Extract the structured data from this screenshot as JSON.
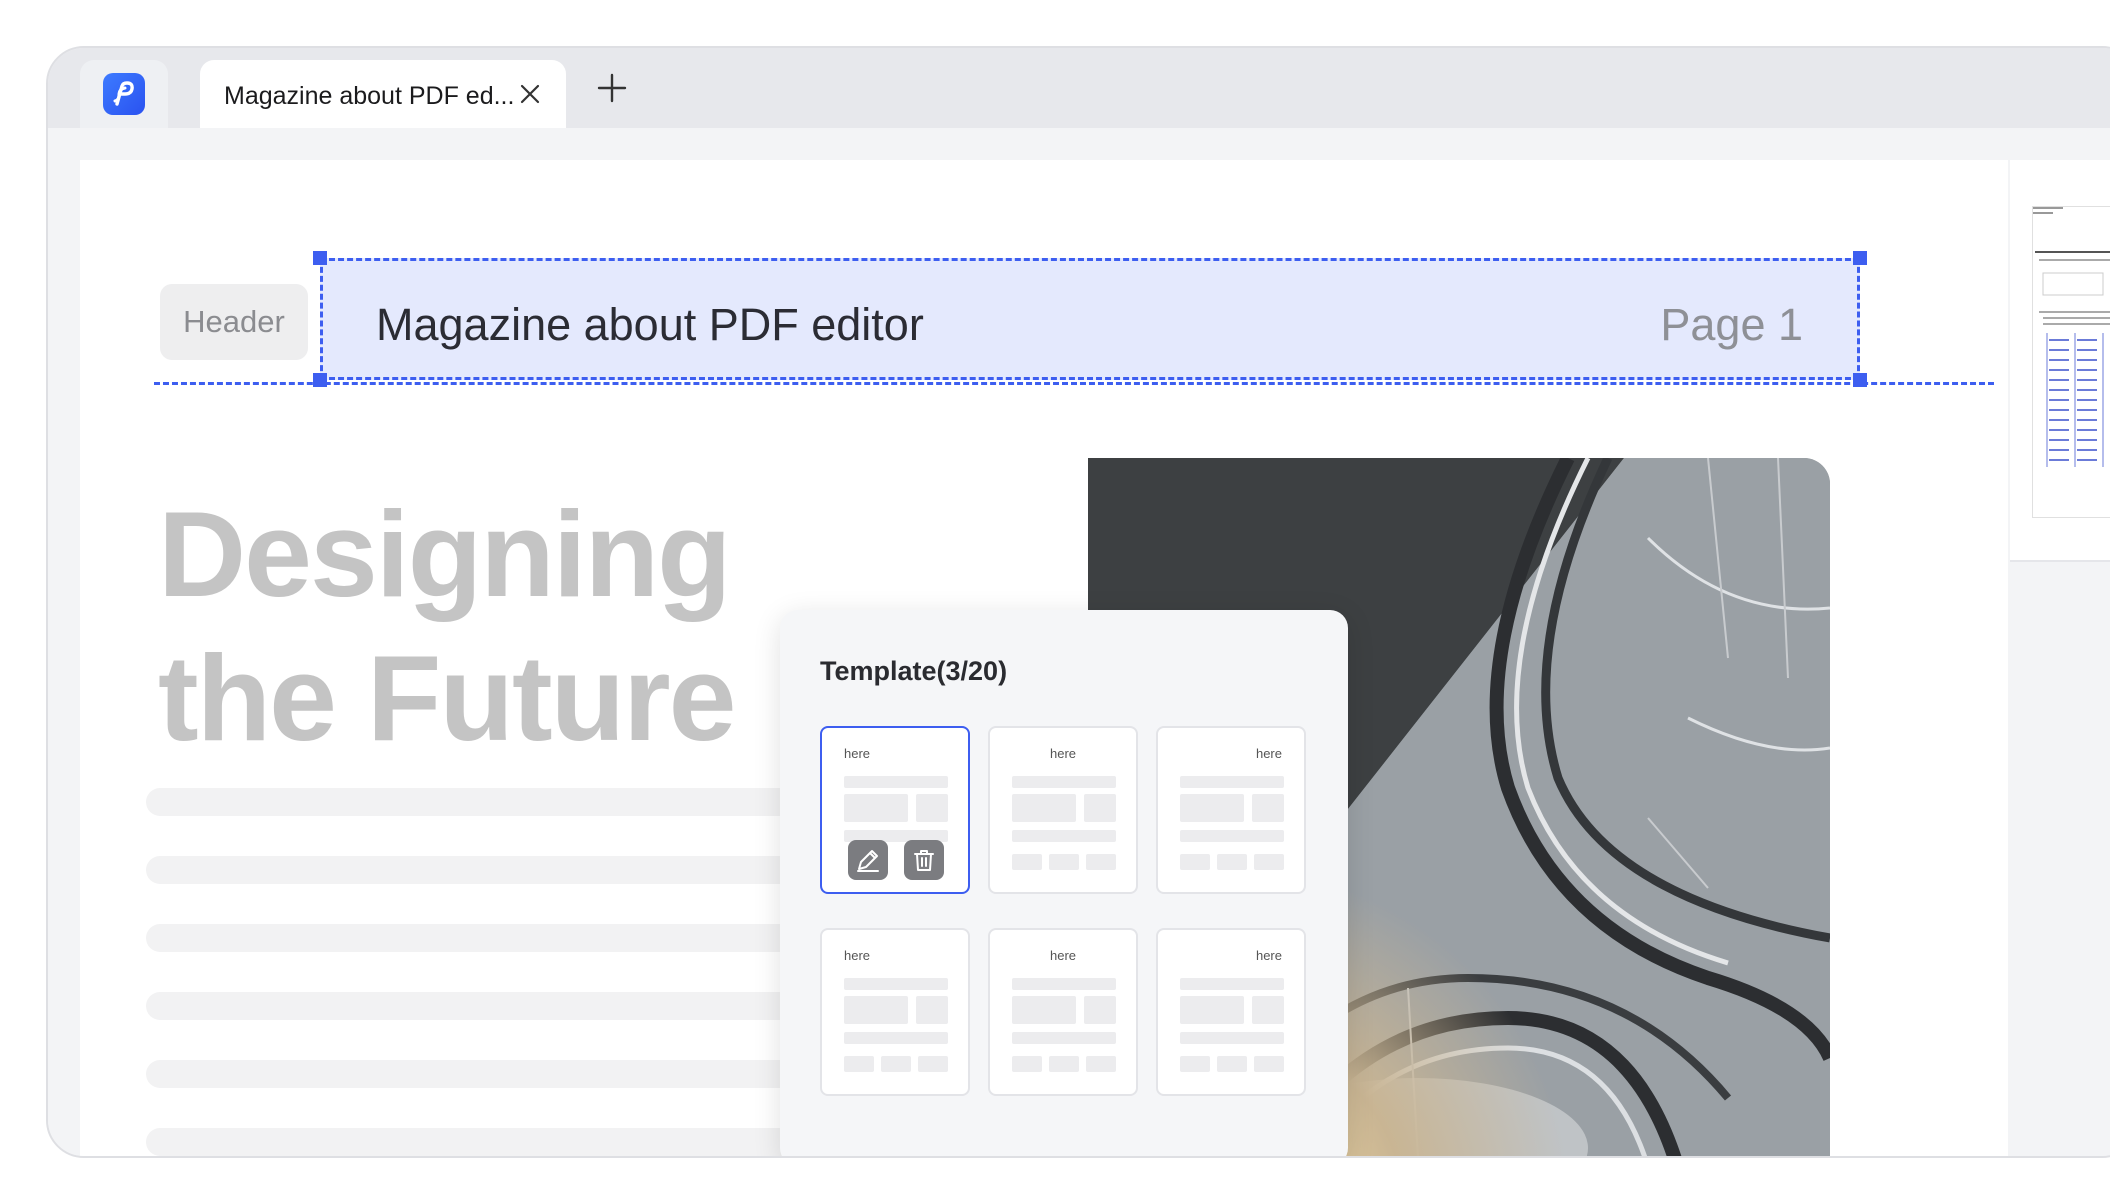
{
  "tabbar": {
    "document_tab_title": "Magazine about PDF ed..."
  },
  "page": {
    "header_chip_label": "Header",
    "header_title": "Magazine about PDF editor",
    "header_page_label": "Page 1",
    "headline_line1": "Designing",
    "headline_line2": "the Future"
  },
  "template_panel": {
    "title": "Template(3/20)",
    "templates": [
      {
        "label": "here",
        "align": "left",
        "selected": true
      },
      {
        "label": "here",
        "align": "center",
        "selected": false
      },
      {
        "label": "here",
        "align": "right",
        "selected": false
      },
      {
        "label": "here",
        "align": "left",
        "selected": false
      },
      {
        "label": "here",
        "align": "center",
        "selected": false
      },
      {
        "label": "here",
        "align": "right",
        "selected": false
      }
    ]
  },
  "colors": {
    "accent": "#3d5ef0",
    "header_highlight": "#e4e9fd"
  }
}
